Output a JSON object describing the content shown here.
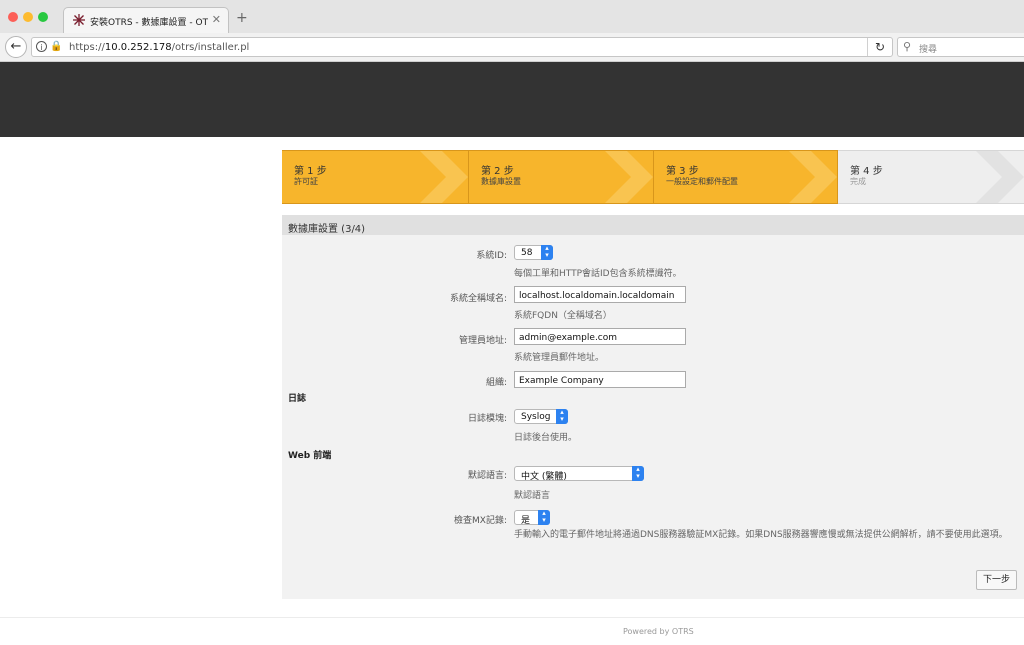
{
  "browser": {
    "tab_title": "安裝OTRS - 數據庫設置 - OTRS",
    "url_host": "10.0.252.178",
    "url_prefix": "https://",
    "url_path": "/otrs/installer.pl",
    "search_placeholder": "搜尋"
  },
  "steps": [
    {
      "number": "第 1 步",
      "label": "許可証",
      "state": "done"
    },
    {
      "number": "第 2 步",
      "label": "數據庫設置",
      "state": "done"
    },
    {
      "number": "第 3 步",
      "label": "一般設定和郵件配置",
      "state": "done"
    },
    {
      "number": "第 4 步",
      "label": "完成",
      "state": "todo"
    }
  ],
  "panel": {
    "title": "數據庫設置 (3/4)",
    "system_id": {
      "label": "系統ID:",
      "value": "58",
      "hint": "每個工單和HTTP會話ID包含系統標識符。"
    },
    "fqdn": {
      "label": "系統全稱域名:",
      "value": "localhost.localdomain.localdomain",
      "hint": "系統FQDN（全稱域名）"
    },
    "admin_email": {
      "label": "管理員地址:",
      "value": "admin@example.com",
      "hint": "系統管理員郵件地址。"
    },
    "organization": {
      "label": "組織:",
      "value": "Example Company"
    },
    "log_section": "日誌",
    "log_module": {
      "label": "日誌模塊:",
      "value": "Syslog",
      "hint": "日誌後台使用。"
    },
    "web_section": "Web 前端",
    "default_language": {
      "label": "默認語言:",
      "value": "中文 (繁體)",
      "hint": "默認語言"
    },
    "check_mx": {
      "label": "檢查MX記錄:",
      "value": "是",
      "hint": "手動輸入的電子郵件地址將通過DNS服務器驗証MX記錄。如果DNS服務器響應慢或無法提供公網解析，請不要使用此選項。"
    },
    "next_button": "下一步"
  },
  "footer": {
    "powered_by": "Powered by OTRS"
  }
}
